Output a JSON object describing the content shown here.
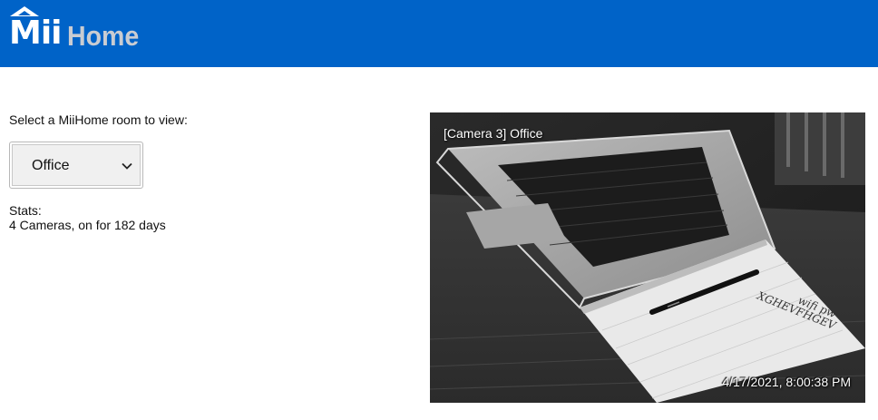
{
  "header": {
    "logo_part1": "Mii",
    "logo_part2": "Home",
    "brand_color": "#0063c8"
  },
  "room_picker": {
    "prompt": "Select a MiiHome room to view:",
    "selected": "Office",
    "icon": "chevron-down-icon"
  },
  "stats": {
    "title": "Stats:",
    "value": "4 Cameras, on for 182 days"
  },
  "camera": {
    "label": "[Camera 3] Office",
    "timestamp": "4/17/2021, 8:00:38 PM",
    "note_line1": "wifi pw",
    "note_line2": "XGHEVFHGEV"
  }
}
